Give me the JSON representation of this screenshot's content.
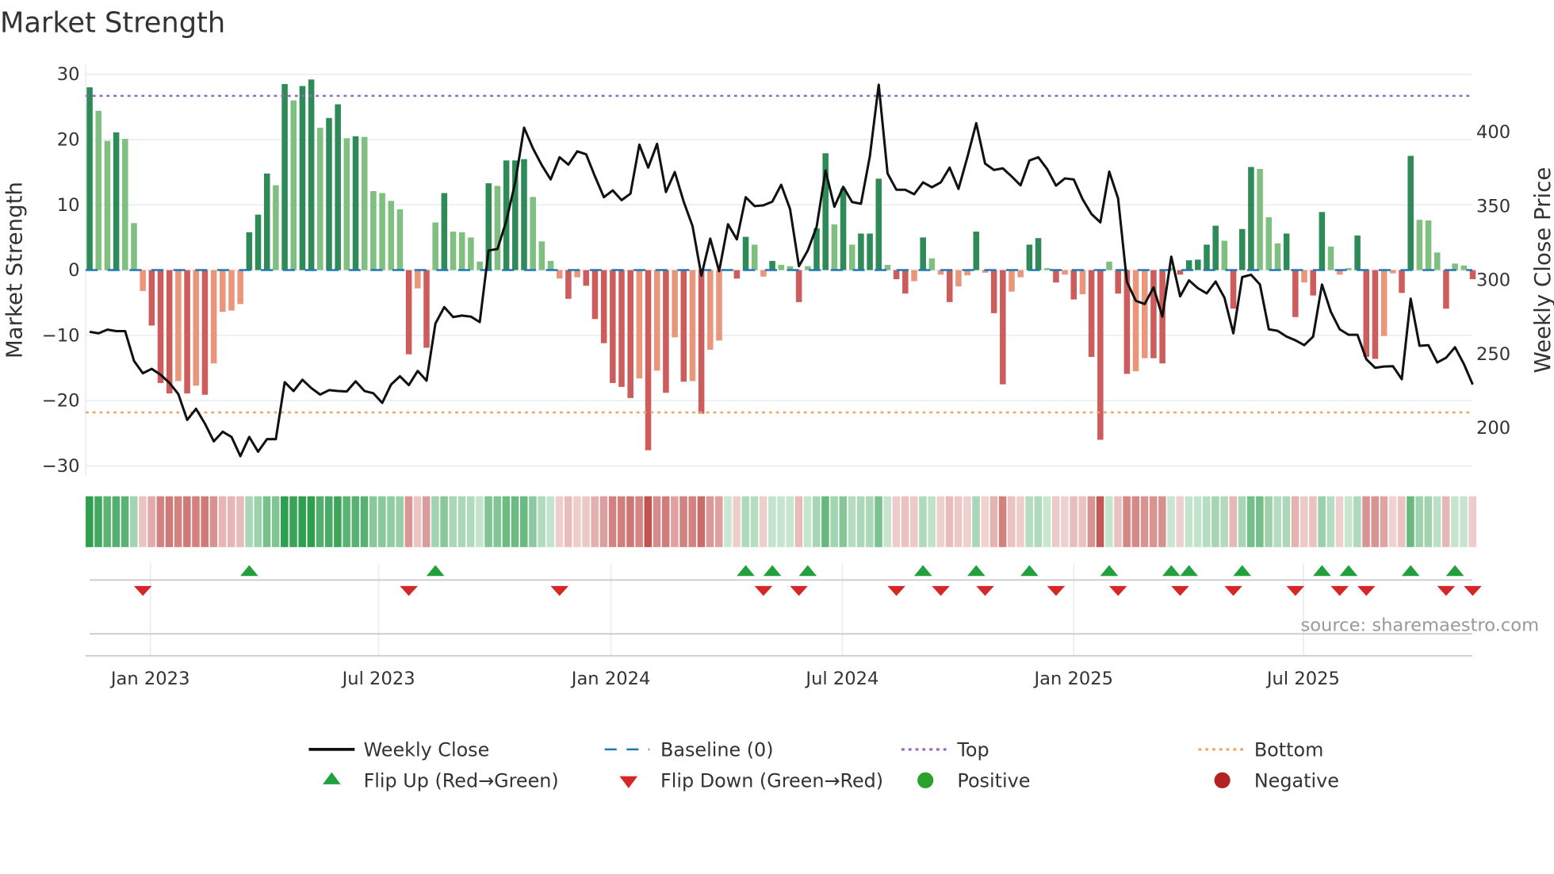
{
  "chart_data": {
    "type": "bar",
    "title": "Market Strength",
    "ylabel": "Market Strength",
    "y2label": "Weekly Close Price",
    "ylim": [
      -30,
      30
    ],
    "y2lim": [
      170,
      435
    ],
    "yticks": [
      "30",
      "20",
      "10",
      "0",
      "−10",
      "−20",
      "−30"
    ],
    "ytick_values": [
      30,
      20,
      10,
      0,
      -10,
      -20,
      -30
    ],
    "y2ticks": [
      "400",
      "350",
      "300",
      "250",
      "200"
    ],
    "y2tick_values": [
      400,
      350,
      300,
      250,
      200
    ],
    "xticks": [
      {
        "label": "Jan 2023",
        "at": 6.85
      },
      {
        "label": "Jul 2023",
        "at": 32.6
      },
      {
        "label": "Jan 2024",
        "at": 58.8
      },
      {
        "label": "Jul 2024",
        "at": 84.9
      },
      {
        "label": "Jan 2025",
        "at": 111.0
      },
      {
        "label": "Jul 2025",
        "at": 136.9
      }
    ],
    "top_level": 26.7,
    "bottom_level": -21.8,
    "strength": [
      28,
      24.4,
      19.8,
      21.1,
      20.1,
      7.2,
      -3.2,
      -8.5,
      -17.3,
      -18.9,
      -17,
      -18.9,
      -17.7,
      -19.1,
      -14.3,
      -6.4,
      -6.2,
      -5.2,
      5.8,
      8.5,
      14.8,
      13,
      28.5,
      26,
      28.2,
      29.2,
      21.8,
      23.3,
      25.4,
      20.2,
      20.5,
      20.4,
      12.1,
      11.8,
      10.6,
      9.3,
      -12.9,
      -2.8,
      -11.9,
      7.3,
      11.8,
      5.9,
      5.8,
      5.0,
      1.3,
      13.3,
      12.9,
      16.8,
      16.8,
      17,
      11.2,
      4.4,
      1.4,
      -1.3,
      -4.4,
      -1.1,
      -2.4,
      -7.5,
      -11.2,
      -17.3,
      -17.9,
      -19.6,
      -16.6,
      -27.6,
      -15.4,
      -18.8,
      -10.3,
      -17.1,
      -17,
      -22,
      -12.2,
      -10.8,
      0,
      -1.3,
      5.1,
      3.9,
      -1.0,
      1.4,
      0.8,
      0.6,
      -4.9,
      0.6,
      6.4,
      17.9,
      7,
      12.5,
      3.9,
      5.6,
      5.6,
      14,
      0.8,
      -1.4,
      -3.6,
      -1.7,
      5,
      1.8,
      -0.7,
      -4.9,
      -2.5,
      -0.8,
      5.9,
      -0.4,
      -6.6,
      -17.5,
      -3.3,
      -1.1,
      3.9,
      4.9,
      0.3,
      -1.9,
      -0.7,
      -4.5,
      -3.7,
      -13.3,
      -26,
      1.3,
      -3.6,
      -15.9,
      -15.5,
      -13.5,
      -13.5,
      -14.3,
      0.4,
      -0.7,
      1.5,
      1.6,
      3.9,
      6.8,
      4.5,
      -5.9,
      6.3,
      15.8,
      15.5,
      8.1,
      4.1,
      5.6,
      -7.2,
      -1.9,
      -3.9,
      8.9,
      3.6,
      -0.7,
      0.3,
      5.3,
      -13.3,
      -13.6,
      -10.1,
      -0.5,
      -3.5,
      17.5,
      7.7,
      7.6,
      2.7,
      -5.9,
      1.0,
      0.7,
      -1.4
    ],
    "weekly_close": [
      265,
      264,
      266.5,
      265.5,
      265.5,
      245.4,
      237,
      240,
      236,
      230.5,
      223,
      205.5,
      213,
      203,
      191,
      197.5,
      194,
      181,
      194,
      184,
      192.5,
      192.5,
      231,
      225,
      232.6,
      227,
      222.6,
      225.6,
      225,
      224.7,
      231.6,
      225,
      223.5,
      217,
      229.4,
      235,
      229,
      238.6,
      232,
      270.6,
      281.7,
      275,
      276,
      275.3,
      271.6,
      320,
      321,
      340,
      366,
      403,
      389,
      377.6,
      368,
      383,
      378,
      387,
      385,
      370,
      356,
      360.6,
      354,
      358.4,
      391.5,
      376,
      392,
      359.5,
      373,
      353,
      336.5,
      303,
      328,
      306,
      337.7,
      327.5,
      356,
      350,
      350.5,
      353,
      364.4,
      348,
      309.4,
      320,
      336,
      374,
      349.5,
      363,
      352.7,
      351.6,
      383.6,
      432,
      372,
      361,
      361,
      358,
      366,
      362.7,
      366,
      376,
      361.6,
      383,
      406,
      378.7,
      374.4,
      375.5,
      370,
      364,
      380.8,
      383,
      375,
      363.8,
      368.7,
      368,
      354.6,
      344.6,
      339,
      373.3,
      355.2,
      298.7,
      286,
      283.8,
      295,
      275.3,
      315.8,
      289,
      299.8,
      294.5,
      291,
      299,
      288,
      264,
      302,
      303.6,
      297,
      266.7,
      265.7,
      261.8,
      259.3,
      256,
      261.8,
      297,
      278.5,
      266.7,
      263,
      263,
      246.5,
      240.7,
      241.6,
      241.8,
      233,
      287.4,
      255.6,
      256,
      244.3,
      247.5,
      254.6,
      243.3,
      229.4
    ],
    "flip_up_weeks": [
      18,
      39,
      74,
      77,
      81,
      94,
      100,
      106,
      115,
      122,
      124,
      130,
      139,
      142,
      149,
      154
    ],
    "flip_down_weeks": [
      6,
      36,
      53,
      76,
      80,
      91,
      96,
      101,
      109,
      116,
      123,
      129,
      136,
      141,
      144,
      153,
      156
    ],
    "legend": {
      "weekly_close": "Weekly Close",
      "baseline": "Baseline (0)",
      "top": "Top",
      "bottom": "Bottom",
      "flip_up": "Flip Up (Red→Green)",
      "flip_down": "Flip Down (Green→Red)",
      "positive": "Positive",
      "negative": "Negative"
    },
    "source": "source: sharemaestro.com",
    "colors": {
      "pos_strong": "#2e8b57",
      "pos_weak": "#7fbf7f",
      "neg_strong": "#cd5c5c",
      "neg_weak": "#e9967a",
      "line": "#111111",
      "baseline": "#1f77b4",
      "top": "#9467bd",
      "bottom": "#f4a261",
      "up": "#22a03c",
      "down": "#d62728",
      "positive": "#2ca02c",
      "negative": "#b22222"
    }
  }
}
